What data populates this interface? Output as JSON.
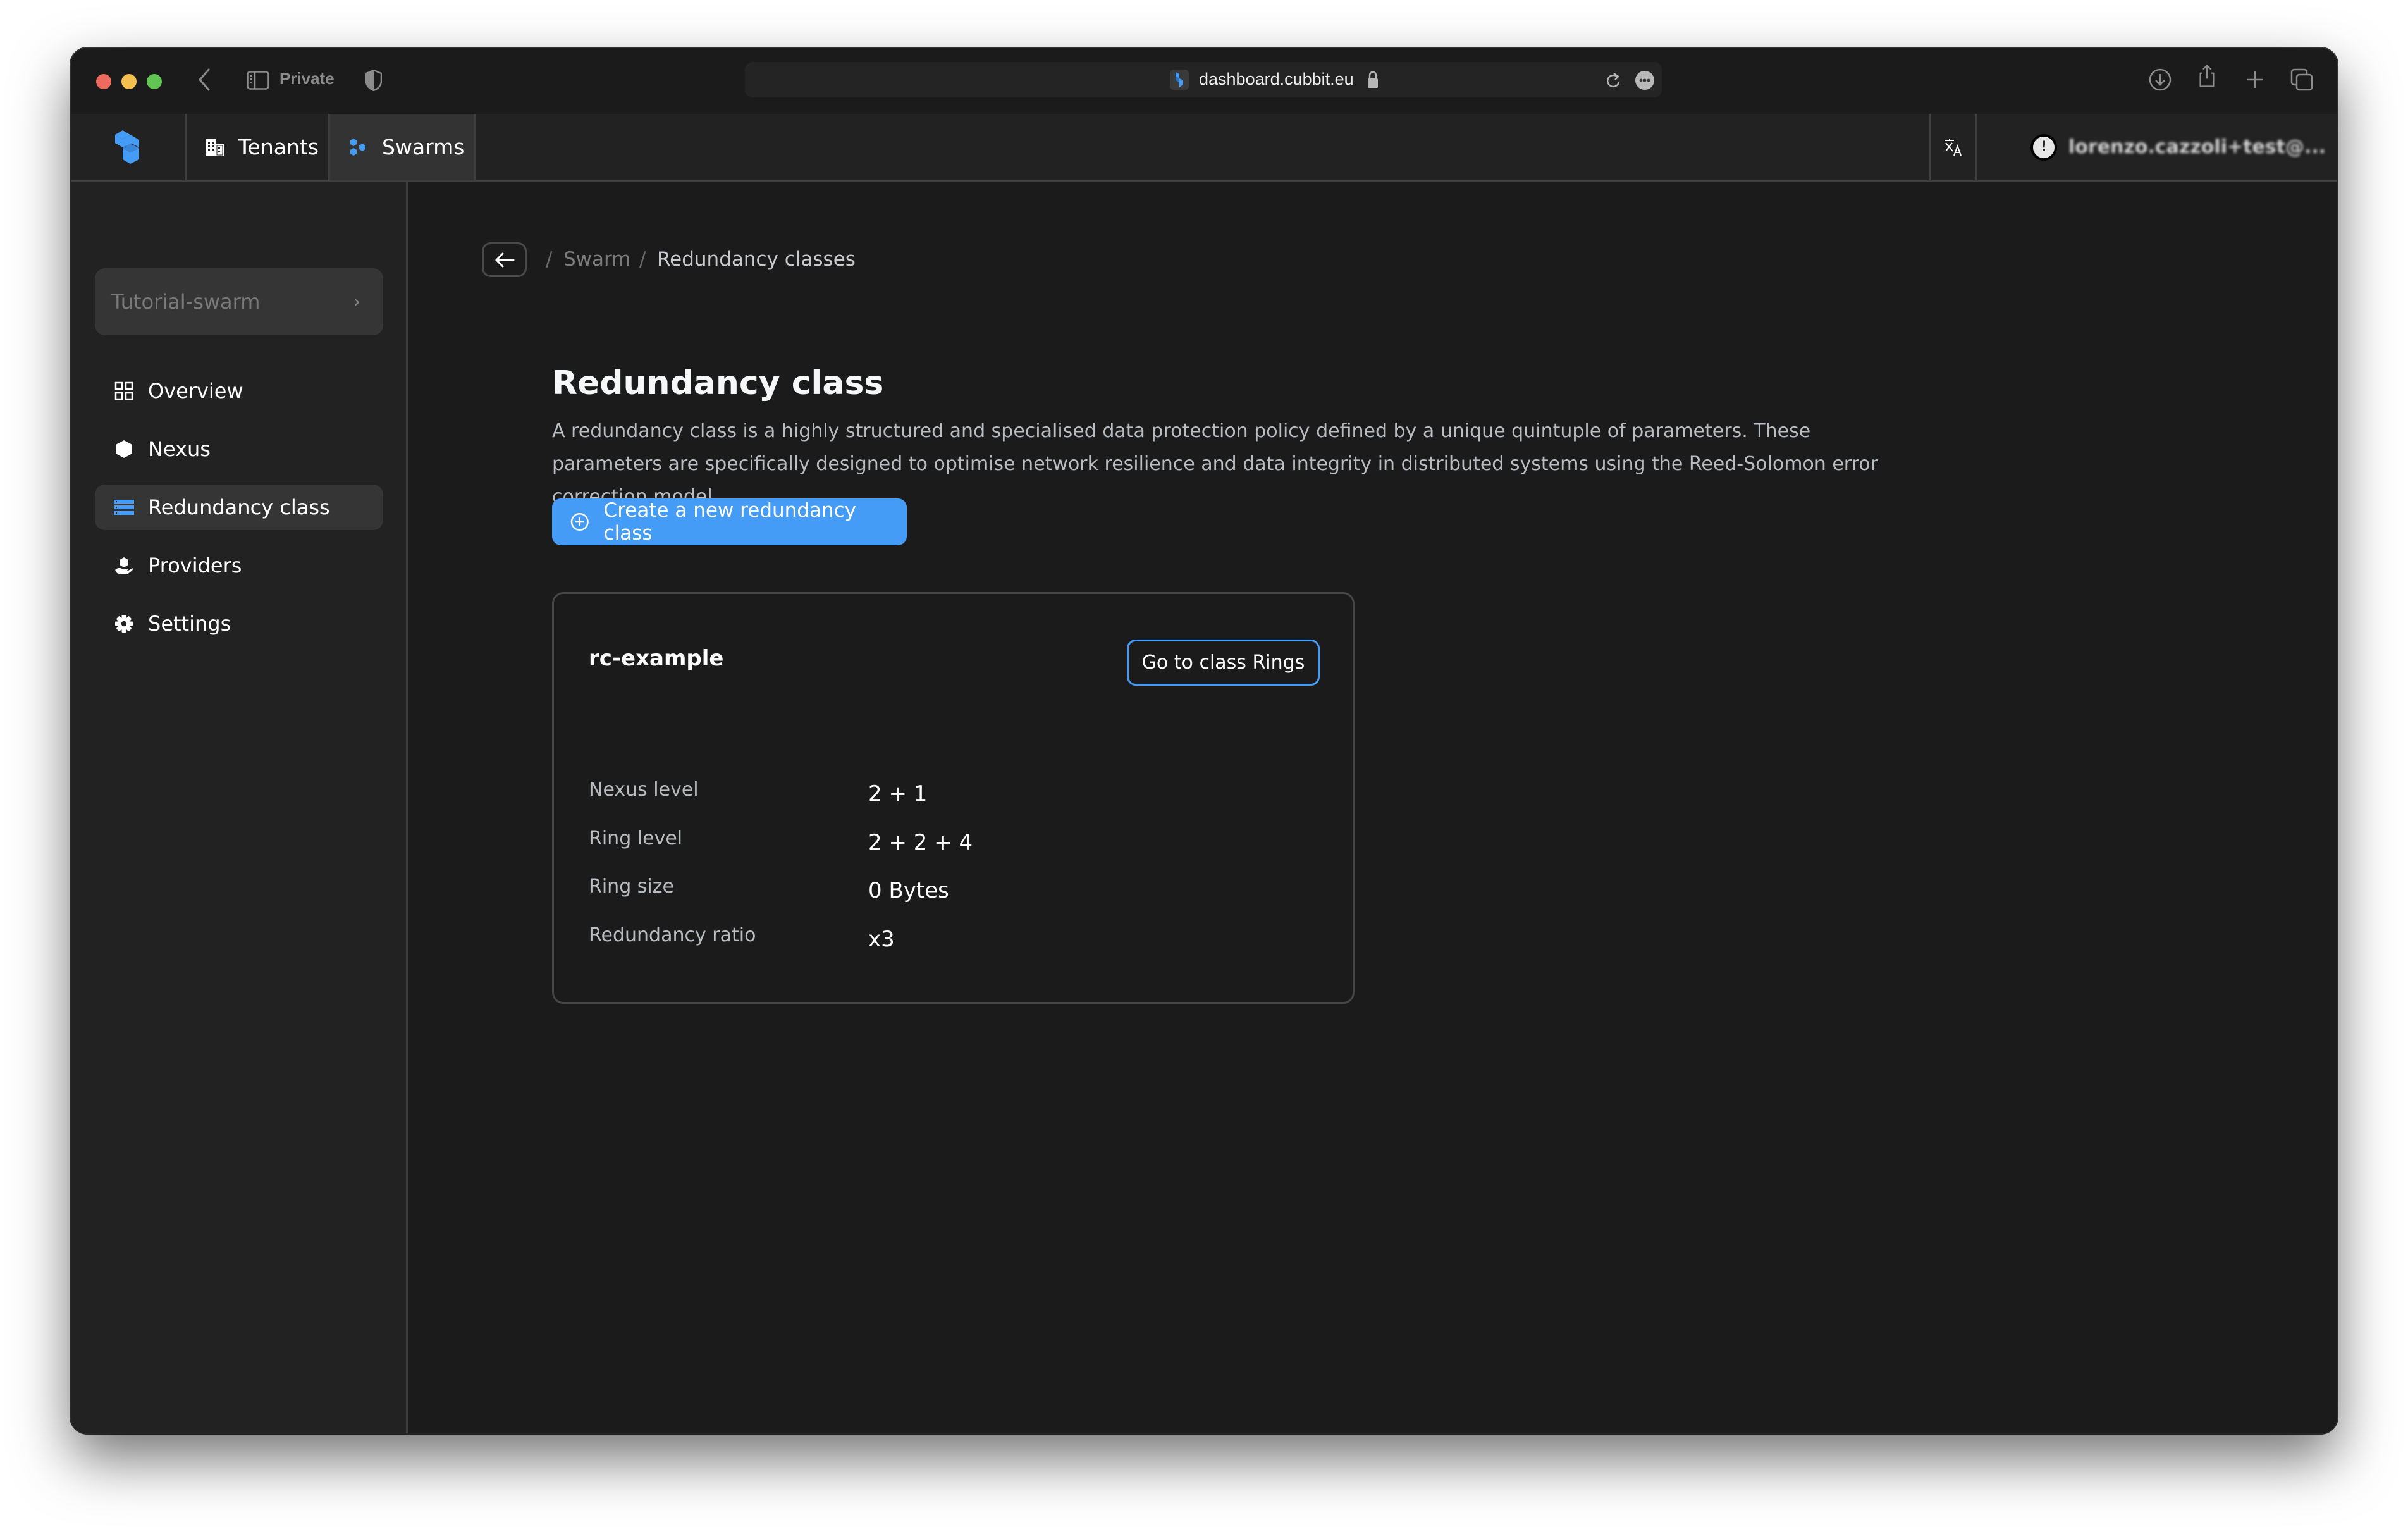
{
  "browser": {
    "private_label": "Private",
    "url": "dashboard.cubbit.eu",
    "toolbar_icons": [
      "download-icon",
      "share-icon",
      "new-tab-icon",
      "tab-overview-icon"
    ]
  },
  "header": {
    "tabs": [
      {
        "label": "Tenants",
        "icon": "building-icon",
        "active": false
      },
      {
        "label": "Swarms",
        "icon": "swarm-icon",
        "active": true
      }
    ],
    "translate_icon": "translate-icon",
    "user": {
      "email": "lorenzo.cazzoli+test@...",
      "avatar_glyph": "!"
    }
  },
  "sidebar": {
    "swarm_selector": {
      "label": "Tutorial-swarm",
      "chevron": "›"
    },
    "items": [
      {
        "label": "Overview",
        "icon": "grid-icon",
        "active": false
      },
      {
        "label": "Nexus",
        "icon": "hexagon-icon",
        "active": false
      },
      {
        "label": "Redundancy class",
        "icon": "server-stack-icon",
        "active": true
      },
      {
        "label": "Providers",
        "icon": "hand-cube-icon",
        "active": false
      },
      {
        "label": "Settings",
        "icon": "gear-icon",
        "active": false
      }
    ]
  },
  "breadcrumb": {
    "separator": "/",
    "items": [
      "Swarm",
      "Redundancy classes"
    ]
  },
  "page": {
    "title": "Redundancy class",
    "description": "A redundancy class is a highly structured and specialised data protection policy defined by a unique quintuple of parameters. These parameters are specifically designed to optimise network resilience and data integrity in distributed systems using the Reed-Solomon error correction model.",
    "create_button": "Create a new redundancy class"
  },
  "classes": [
    {
      "name": "rc-example",
      "action_label": "Go to class Rings",
      "properties": [
        {
          "label": "Nexus level",
          "value": "2 + 1"
        },
        {
          "label": "Ring level",
          "value": "2 + 2 + 4"
        },
        {
          "label": "Ring size",
          "value": "0 Bytes"
        },
        {
          "label": "Redundancy ratio",
          "value": "x3"
        }
      ]
    }
  ],
  "colors": {
    "accent": "#449cf6",
    "window_bg": "#1b1b1b",
    "panel_bg": "#222222",
    "active_bg": "#353535"
  }
}
